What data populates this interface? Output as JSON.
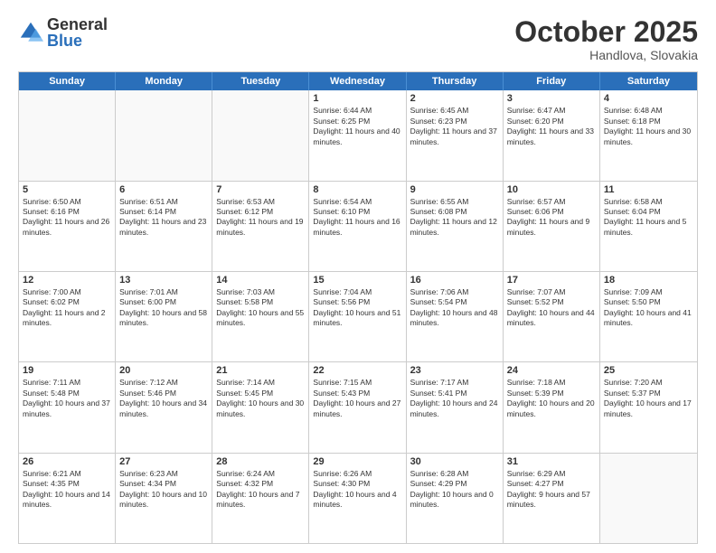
{
  "logo": {
    "general": "General",
    "blue": "Blue"
  },
  "header": {
    "month": "October 2025",
    "location": "Handlova, Slovakia"
  },
  "weekdays": [
    "Sunday",
    "Monday",
    "Tuesday",
    "Wednesday",
    "Thursday",
    "Friday",
    "Saturday"
  ],
  "rows": [
    [
      {
        "day": "",
        "empty": true
      },
      {
        "day": "",
        "empty": true
      },
      {
        "day": "",
        "empty": true
      },
      {
        "day": "1",
        "sunrise": "6:44 AM",
        "sunset": "6:25 PM",
        "daylight": "11 hours and 40 minutes."
      },
      {
        "day": "2",
        "sunrise": "6:45 AM",
        "sunset": "6:23 PM",
        "daylight": "11 hours and 37 minutes."
      },
      {
        "day": "3",
        "sunrise": "6:47 AM",
        "sunset": "6:20 PM",
        "daylight": "11 hours and 33 minutes."
      },
      {
        "day": "4",
        "sunrise": "6:48 AM",
        "sunset": "6:18 PM",
        "daylight": "11 hours and 30 minutes."
      }
    ],
    [
      {
        "day": "5",
        "sunrise": "6:50 AM",
        "sunset": "6:16 PM",
        "daylight": "11 hours and 26 minutes."
      },
      {
        "day": "6",
        "sunrise": "6:51 AM",
        "sunset": "6:14 PM",
        "daylight": "11 hours and 23 minutes."
      },
      {
        "day": "7",
        "sunrise": "6:53 AM",
        "sunset": "6:12 PM",
        "daylight": "11 hours and 19 minutes."
      },
      {
        "day": "8",
        "sunrise": "6:54 AM",
        "sunset": "6:10 PM",
        "daylight": "11 hours and 16 minutes."
      },
      {
        "day": "9",
        "sunrise": "6:55 AM",
        "sunset": "6:08 PM",
        "daylight": "11 hours and 12 minutes."
      },
      {
        "day": "10",
        "sunrise": "6:57 AM",
        "sunset": "6:06 PM",
        "daylight": "11 hours and 9 minutes."
      },
      {
        "day": "11",
        "sunrise": "6:58 AM",
        "sunset": "6:04 PM",
        "daylight": "11 hours and 5 minutes."
      }
    ],
    [
      {
        "day": "12",
        "sunrise": "7:00 AM",
        "sunset": "6:02 PM",
        "daylight": "11 hours and 2 minutes."
      },
      {
        "day": "13",
        "sunrise": "7:01 AM",
        "sunset": "6:00 PM",
        "daylight": "10 hours and 58 minutes."
      },
      {
        "day": "14",
        "sunrise": "7:03 AM",
        "sunset": "5:58 PM",
        "daylight": "10 hours and 55 minutes."
      },
      {
        "day": "15",
        "sunrise": "7:04 AM",
        "sunset": "5:56 PM",
        "daylight": "10 hours and 51 minutes."
      },
      {
        "day": "16",
        "sunrise": "7:06 AM",
        "sunset": "5:54 PM",
        "daylight": "10 hours and 48 minutes."
      },
      {
        "day": "17",
        "sunrise": "7:07 AM",
        "sunset": "5:52 PM",
        "daylight": "10 hours and 44 minutes."
      },
      {
        "day": "18",
        "sunrise": "7:09 AM",
        "sunset": "5:50 PM",
        "daylight": "10 hours and 41 minutes."
      }
    ],
    [
      {
        "day": "19",
        "sunrise": "7:11 AM",
        "sunset": "5:48 PM",
        "daylight": "10 hours and 37 minutes."
      },
      {
        "day": "20",
        "sunrise": "7:12 AM",
        "sunset": "5:46 PM",
        "daylight": "10 hours and 34 minutes."
      },
      {
        "day": "21",
        "sunrise": "7:14 AM",
        "sunset": "5:45 PM",
        "daylight": "10 hours and 30 minutes."
      },
      {
        "day": "22",
        "sunrise": "7:15 AM",
        "sunset": "5:43 PM",
        "daylight": "10 hours and 27 minutes."
      },
      {
        "day": "23",
        "sunrise": "7:17 AM",
        "sunset": "5:41 PM",
        "daylight": "10 hours and 24 minutes."
      },
      {
        "day": "24",
        "sunrise": "7:18 AM",
        "sunset": "5:39 PM",
        "daylight": "10 hours and 20 minutes."
      },
      {
        "day": "25",
        "sunrise": "7:20 AM",
        "sunset": "5:37 PM",
        "daylight": "10 hours and 17 minutes."
      }
    ],
    [
      {
        "day": "26",
        "sunrise": "6:21 AM",
        "sunset": "4:35 PM",
        "daylight": "10 hours and 14 minutes."
      },
      {
        "day": "27",
        "sunrise": "6:23 AM",
        "sunset": "4:34 PM",
        "daylight": "10 hours and 10 minutes."
      },
      {
        "day": "28",
        "sunrise": "6:24 AM",
        "sunset": "4:32 PM",
        "daylight": "10 hours and 7 minutes."
      },
      {
        "day": "29",
        "sunrise": "6:26 AM",
        "sunset": "4:30 PM",
        "daylight": "10 hours and 4 minutes."
      },
      {
        "day": "30",
        "sunrise": "6:28 AM",
        "sunset": "4:29 PM",
        "daylight": "10 hours and 0 minutes."
      },
      {
        "day": "31",
        "sunrise": "6:29 AM",
        "sunset": "4:27 PM",
        "daylight": "9 hours and 57 minutes."
      },
      {
        "day": "",
        "empty": true
      }
    ]
  ]
}
